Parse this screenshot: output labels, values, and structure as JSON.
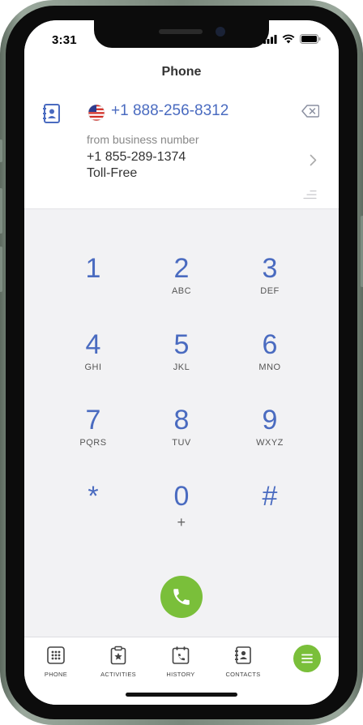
{
  "status_bar": {
    "time": "3:31"
  },
  "header": {
    "title": "Phone"
  },
  "dialer": {
    "dialed_number": "+1 888-256-8312",
    "from_label": "from business number",
    "from_number": "+1 855-289-1374",
    "from_type": "Toll-Free"
  },
  "keypad": [
    {
      "digit": "1",
      "letters": ""
    },
    {
      "digit": "2",
      "letters": "ABC"
    },
    {
      "digit": "3",
      "letters": "DEF"
    },
    {
      "digit": "4",
      "letters": "GHI"
    },
    {
      "digit": "5",
      "letters": "JKL"
    },
    {
      "digit": "6",
      "letters": "MNO"
    },
    {
      "digit": "7",
      "letters": "PQRS"
    },
    {
      "digit": "8",
      "letters": "TUV"
    },
    {
      "digit": "9",
      "letters": "WXYZ"
    },
    {
      "digit": "*",
      "letters": ""
    },
    {
      "digit": "0",
      "letters": "+"
    },
    {
      "digit": "#",
      "letters": ""
    }
  ],
  "tabbar": {
    "phone": "PHONE",
    "activities": "ACTIVITIES",
    "history": "HISTORY",
    "contacts": "CONTACTS"
  },
  "colors": {
    "accent": "#4a6bc0",
    "call_green": "#7abf3a"
  }
}
